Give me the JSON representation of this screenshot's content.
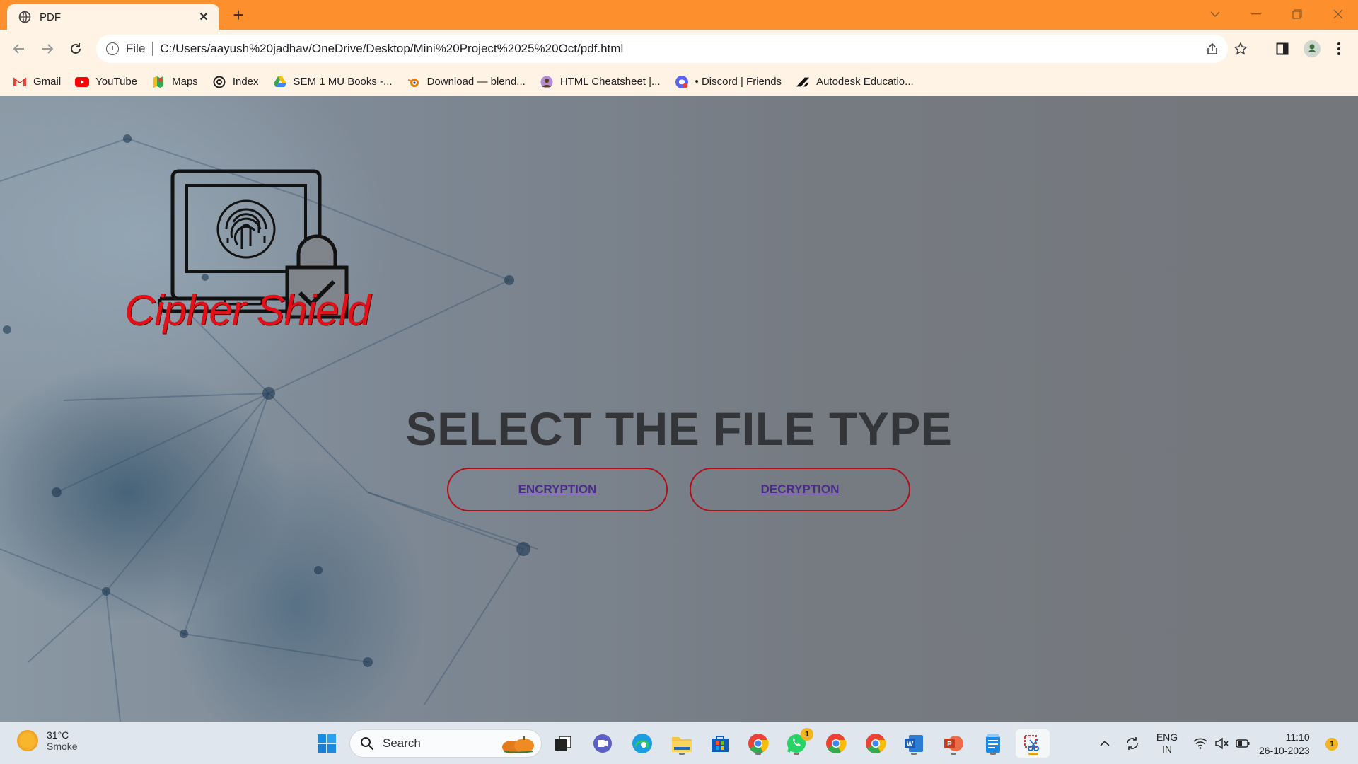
{
  "browser": {
    "tab_title": "PDF",
    "address_scheme": "File",
    "url": "C:/Users/aayush%20jadhav/OneDrive/Desktop/Mini%20Project%2025%20Oct/pdf.html",
    "bookmarks": [
      {
        "label": "Gmail",
        "icon": "gmail-icon"
      },
      {
        "label": "YouTube",
        "icon": "youtube-icon"
      },
      {
        "label": "Maps",
        "icon": "maps-icon"
      },
      {
        "label": "Index",
        "icon": "index-icon"
      },
      {
        "label": "SEM 1 MU Books -...",
        "icon": "drive-icon"
      },
      {
        "label": "Download — blend...",
        "icon": "blender-icon"
      },
      {
        "label": "HTML Cheatsheet |...",
        "icon": "avatar-icon"
      },
      {
        "label": "• Discord | Friends",
        "icon": "discord-icon"
      },
      {
        "label": "Autodesk Educatio...",
        "icon": "autodesk-icon"
      }
    ]
  },
  "page": {
    "brand": "Cipher Shield",
    "heading": "SELECT THE FILE TYPE",
    "encrypt_label": "ENCRYPTION",
    "decrypt_label": "DECRYPTION"
  },
  "taskbar": {
    "weather_temp": "31°C",
    "weather_desc": "Smoke",
    "search_placeholder": "Search",
    "lang_top": "ENG",
    "lang_bottom": "IN",
    "time": "11:10",
    "date": "26-10-2023",
    "notification_count": "1",
    "whatsapp_badge": "1"
  },
  "colors": {
    "tabbar": "#fe8f2d",
    "toolbar": "#fff3e6",
    "brand_red": "#e3101a",
    "button_border": "#b0101a",
    "link": "#4b2a8c"
  }
}
